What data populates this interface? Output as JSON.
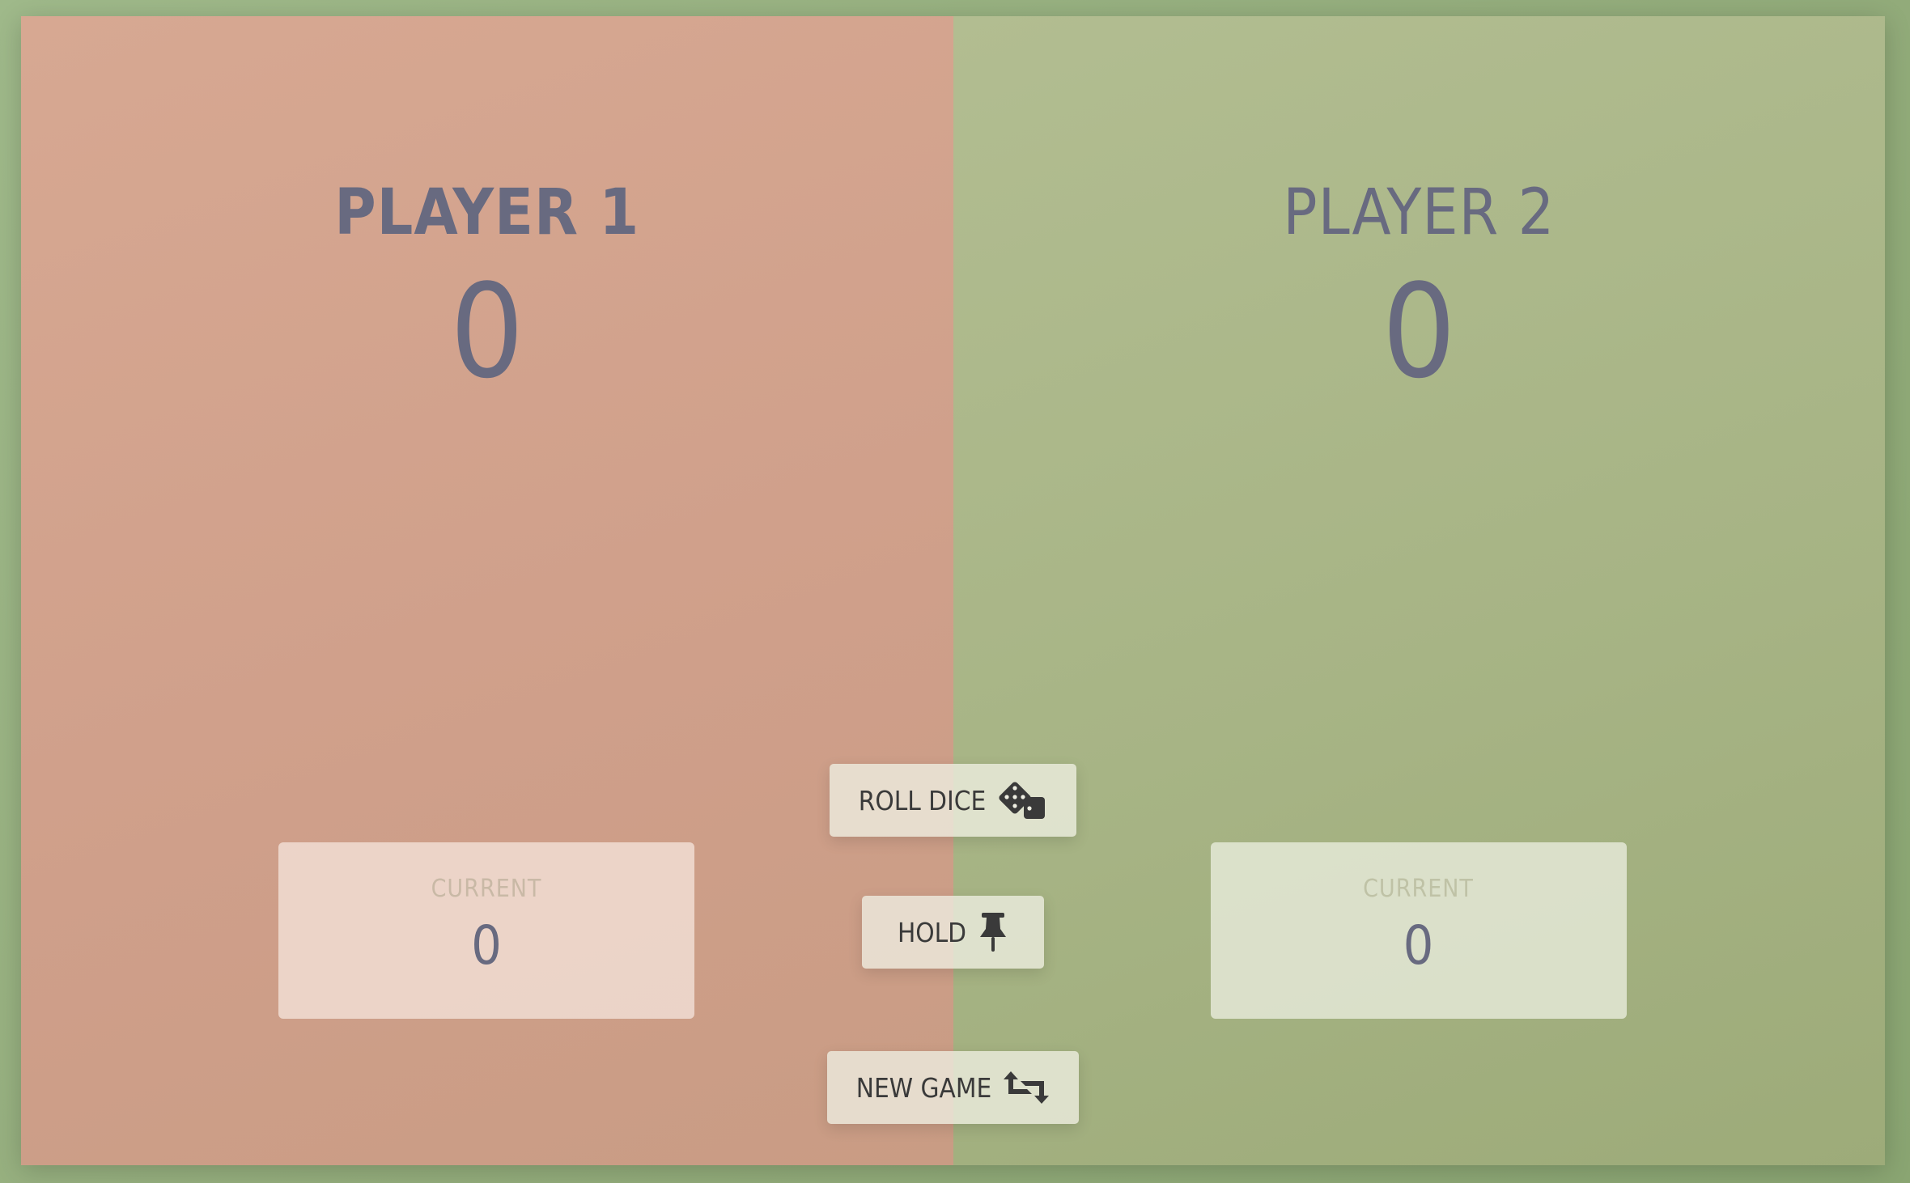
{
  "players": [
    {
      "name": "PLAYER 1",
      "score": "0",
      "current_label": "CURRENT",
      "current_score": "0"
    },
    {
      "name": "PLAYER 2",
      "score": "0",
      "current_label": "CURRENT",
      "current_score": "0"
    }
  ],
  "buttons": {
    "roll_dice": {
      "label": "ROLL DICE",
      "icon": "dice-icon"
    },
    "hold": {
      "label": "HOLD",
      "icon": "pushpin-icon"
    },
    "new_game": {
      "label": "NEW GAME",
      "icon": "retweet-icon"
    }
  },
  "active_player": 1,
  "colors": {
    "player1_panel": "#d2a28c",
    "player2_panel": "#a9b687",
    "background": "#97b07f",
    "text": "#686a80",
    "button_text": "#3a3a3a"
  }
}
